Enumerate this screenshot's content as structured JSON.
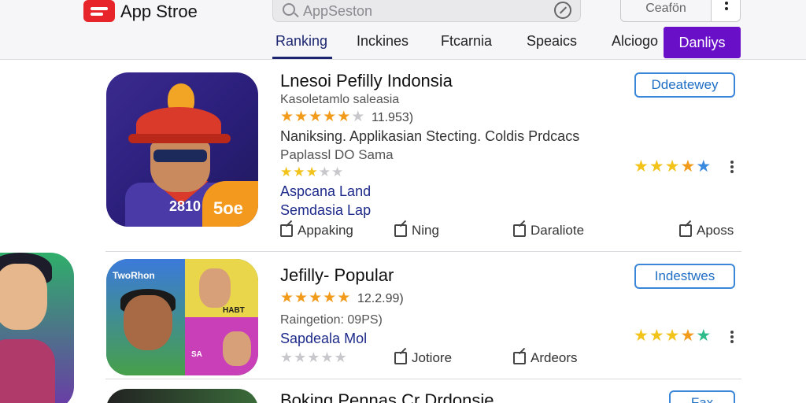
{
  "header": {
    "brand": "App Stroe",
    "search_placeholder": "AppSeston",
    "account_label": "Ceafön"
  },
  "tabs": [
    {
      "label": "Ranking",
      "active": true
    },
    {
      "label": "Inckines",
      "active": false
    },
    {
      "label": "Ftcarnia",
      "active": false
    },
    {
      "label": "Speaics",
      "active": false
    },
    {
      "label": "Alciogo",
      "active": false
    },
    {
      "label": "Danliys",
      "active": false,
      "highlight": true
    }
  ],
  "apps": [
    {
      "title": "Lnesoi Pefilly Indonsia",
      "subtitle": "Kasoletamlo saleasia",
      "rating_count": "11.953)",
      "description": "Naniksing. Applikasian Stecting. Coldis Prdcacs",
      "description2": "Paplassl DO Sama",
      "link1": "Aspcana Land",
      "link2": "Semdasia Lap",
      "icon_num_left": "2810",
      "icon_num_right": "5oe",
      "actions": [
        "Appaking",
        "Ning",
        "Daraliote",
        "Aposs"
      ],
      "button_label": "Ddeatewey"
    },
    {
      "title": "Jefilly- Popular",
      "rating_count": "12.2.99)",
      "meta": "Raingetion: 09PS)",
      "link1": "Sapdeala Mol",
      "icon_label_a": "TwoRhon",
      "icon_label_b": "SA",
      "icon_label_c": "HABT",
      "actions": [
        "Jotiore",
        "Ardeors"
      ],
      "button_label": "Indestwes"
    },
    {
      "title": "Boking Pennas Cr Drdonsie",
      "button_label": "Fax"
    }
  ],
  "colors": {
    "accent": "#6a0fc8",
    "tab_active": "#1c2670",
    "star": "#f29a1a",
    "button_border": "#3a86d8",
    "brand_red": "#e8242b"
  },
  "icons": [
    "brand-logo-icon",
    "search-icon",
    "compass-icon",
    "kebab-icon",
    "edit-icon",
    "share-icon"
  ]
}
